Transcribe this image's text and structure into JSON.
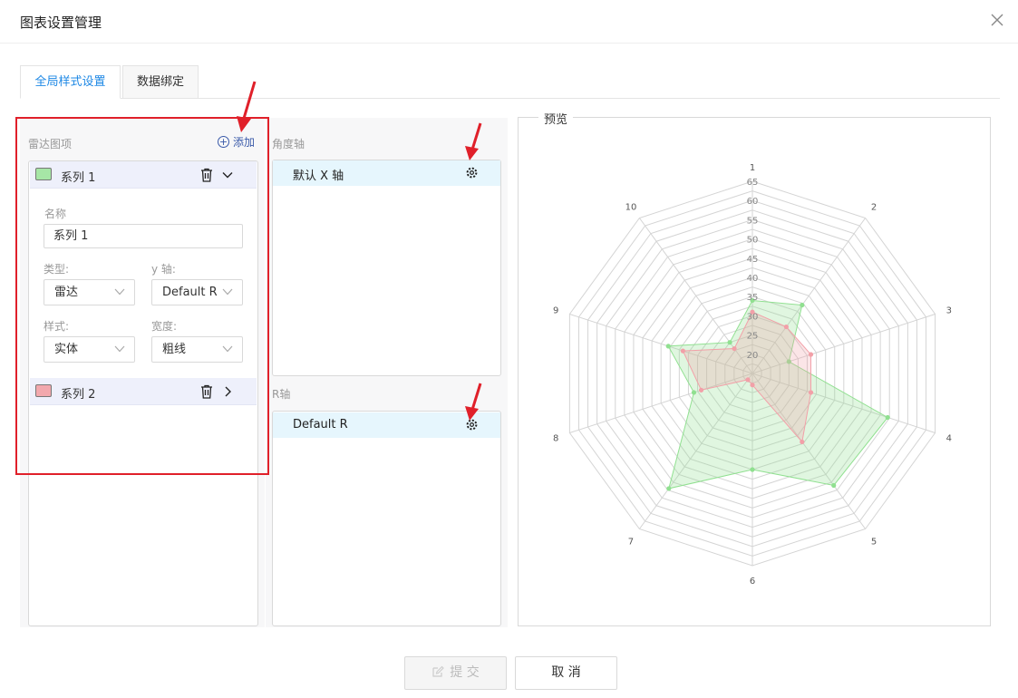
{
  "dialog": {
    "title": "图表设置管理",
    "close_icon": "close-icon"
  },
  "tabs": [
    {
      "label": "全局样式设置",
      "active": true
    },
    {
      "label": "数据绑定",
      "active": false
    }
  ],
  "radar_items": {
    "label": "雷达图项",
    "add_label": "添加",
    "series": [
      {
        "name": "系列 1",
        "color": "#a6e6a6",
        "expanded": true
      },
      {
        "name": "系列 2",
        "color": "#f2a8ad",
        "expanded": false
      }
    ],
    "form": {
      "name_label": "名称",
      "name_value": "系列 1",
      "type_label": "类型:",
      "type_value": "雷达",
      "yaxis_label": "y 轴:",
      "yaxis_value": "Default R",
      "style_label": "样式:",
      "style_value": "实体",
      "width_label": "宽度:",
      "width_value": "粗线"
    }
  },
  "angle_axis": {
    "label": "角度轴",
    "items": [
      "默认 X 轴"
    ]
  },
  "r_axis": {
    "label": "R轴",
    "items": [
      "Default R"
    ]
  },
  "preview": {
    "label": "预览"
  },
  "buttons": {
    "submit": "提 交",
    "cancel": "取 消"
  },
  "chart_data": {
    "type": "radar",
    "categories": [
      "1",
      "2",
      "3",
      "4",
      "5",
      "6",
      "7",
      "8",
      "9",
      "10"
    ],
    "r_ticks": [
      20,
      25,
      30,
      35,
      40,
      45,
      50,
      55,
      60,
      65
    ],
    "rlim": [
      15,
      65
    ],
    "series": [
      {
        "name": "系列 1",
        "color": "#90e090",
        "values": [
          34,
          37,
          25,
          52,
          51,
          40,
          52,
          31,
          38,
          25
        ]
      },
      {
        "name": "系列 2",
        "color": "#f2a0a8",
        "values": [
          31,
          30,
          31,
          31,
          37,
          18,
          17,
          29,
          34,
          23
        ]
      }
    ]
  }
}
